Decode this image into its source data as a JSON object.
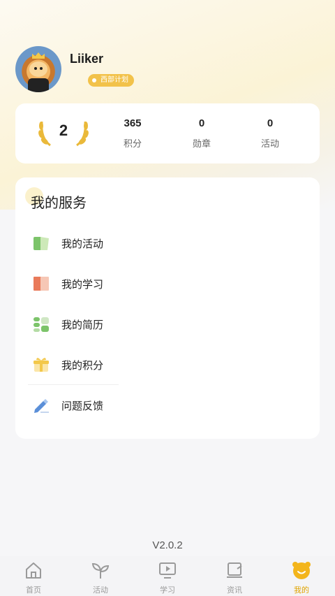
{
  "profile": {
    "username": "Liiker",
    "tag_label": "西部计划"
  },
  "stats": {
    "rank": "2",
    "items": [
      {
        "value": "365",
        "label": "积分"
      },
      {
        "value": "0",
        "label": "勋章"
      },
      {
        "value": "0",
        "label": "活动"
      }
    ]
  },
  "services": {
    "title": "我的服务",
    "items": [
      {
        "label": "我的活动",
        "icon": "activity-icon"
      },
      {
        "label": "我的学习",
        "icon": "study-icon"
      },
      {
        "label": "我的简历",
        "icon": "resume-icon"
      },
      {
        "label": "我的积分",
        "icon": "points-icon"
      },
      {
        "label": "问题反馈",
        "icon": "feedback-icon"
      }
    ]
  },
  "version": "V2.0.2",
  "tabbar": {
    "items": [
      {
        "label": "首页",
        "icon": "home-icon"
      },
      {
        "label": "活动",
        "icon": "sprout-icon"
      },
      {
        "label": "学习",
        "icon": "video-icon"
      },
      {
        "label": "资讯",
        "icon": "news-icon"
      },
      {
        "label": "我的",
        "icon": "bear-icon"
      }
    ],
    "active_index": 4
  },
  "colors": {
    "accent": "#f2c24a",
    "active_tab": "#e0a400",
    "inactive_tab": "#9a9a9a"
  }
}
